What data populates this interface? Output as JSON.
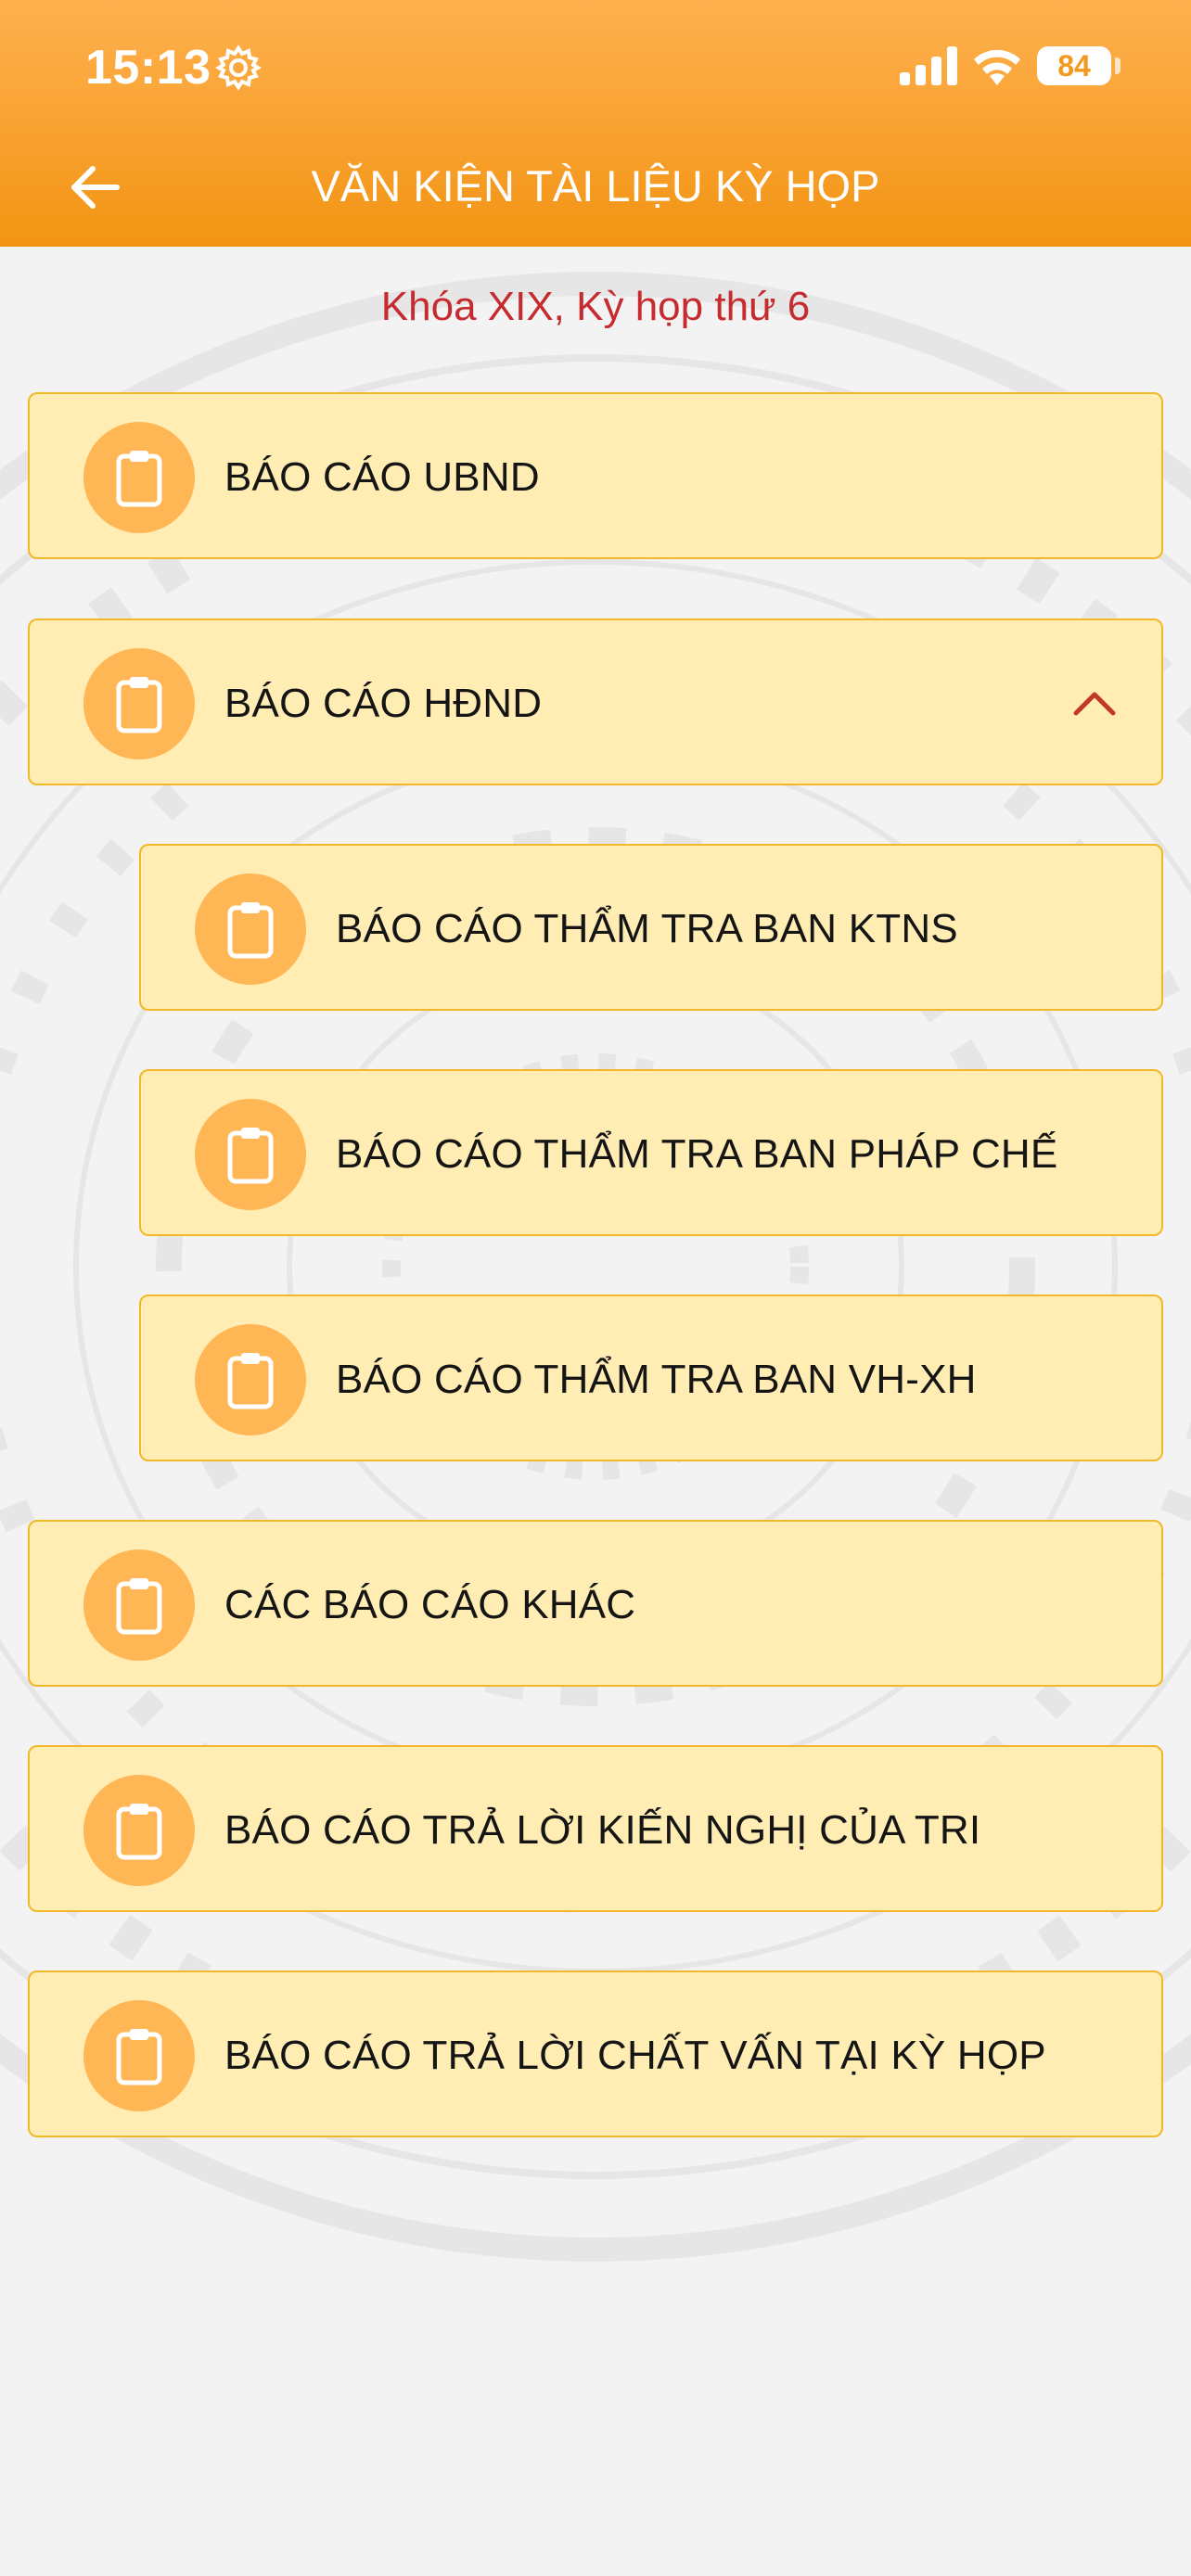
{
  "status_bar": {
    "time": "15:13",
    "battery": "84",
    "icons": [
      "gear-icon",
      "signal-icon",
      "wifi-icon",
      "battery-icon"
    ]
  },
  "header": {
    "title": "VĂN KIỆN TÀI LIỆU KỲ HỌP",
    "back_icon": "arrow-left-icon"
  },
  "subtitle": "Khóa XIX, Kỳ họp thứ 6",
  "menu": {
    "items": [
      {
        "label": "BÁO CÁO UBND",
        "icon": "clipboard-icon"
      },
      {
        "label": "BÁO CÁO HĐND",
        "icon": "clipboard-icon",
        "expanded": true,
        "chevron": "chevron-up-icon"
      },
      {
        "label": "BÁO CÁO THẨM TRA BAN KTNS",
        "icon": "clipboard-icon",
        "level": 2
      },
      {
        "label": "BÁO CÁO THẨM TRA BAN PHÁP CHẾ",
        "icon": "clipboard-icon",
        "level": 2
      },
      {
        "label": "BÁO CÁO THẨM TRA BAN VH-XH",
        "icon": "clipboard-icon",
        "level": 2
      },
      {
        "label": "CÁC BÁO CÁO KHÁC",
        "icon": "clipboard-icon"
      },
      {
        "label": "BÁO CÁO TRẢ LỜI KIẾN NGHỊ CỦA TRI",
        "icon": "clipboard-icon"
      },
      {
        "label": "BÁO CÁO TRẢ LỜI CHẤT VẤN TẠI KỲ HỌP",
        "icon": "clipboard-icon"
      }
    ]
  },
  "colors": {
    "header_top": "#ffb14e",
    "header_bottom": "#f29412",
    "item_fill": "#ffedb3",
    "item_border": "#f2b827",
    "icon_circle": "#ffb655",
    "subtitle": "#c62b2f",
    "chevron": "#c0392b"
  }
}
